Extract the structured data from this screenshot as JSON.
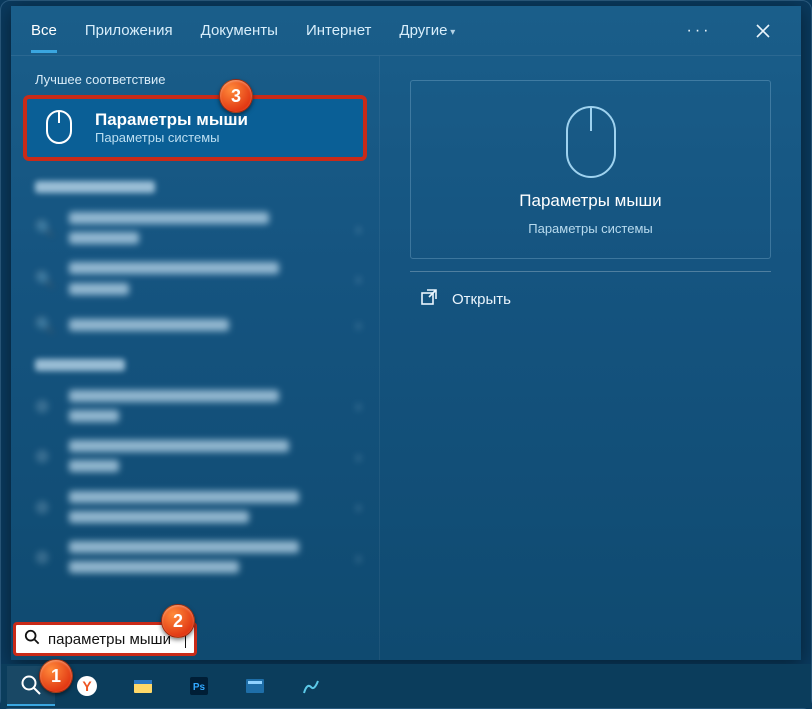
{
  "tabs": {
    "all": "Все",
    "apps": "Приложения",
    "docs": "Документы",
    "web": "Интернет",
    "more": "Другие"
  },
  "sections": {
    "best": "Лучшее соответствие"
  },
  "best": {
    "title": "Параметры мыши",
    "subtitle": "Параметры системы"
  },
  "detail": {
    "title": "Параметры мыши",
    "subtitle": "Параметры системы",
    "open": "Открыть"
  },
  "search": {
    "value": "параметры мыши"
  },
  "badges": {
    "b1": "1",
    "b2": "2",
    "b3": "3"
  }
}
